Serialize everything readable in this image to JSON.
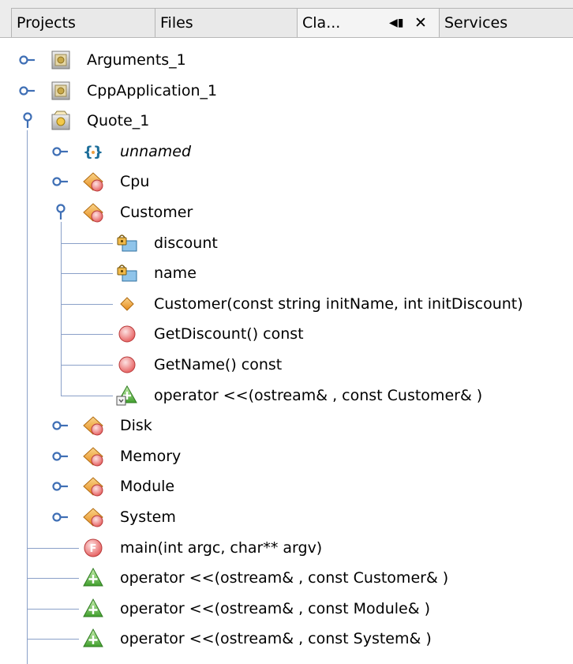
{
  "tabs": [
    {
      "label": "Projects"
    },
    {
      "label": "Files"
    },
    {
      "label": "Cla...",
      "active": true
    },
    {
      "label": "Services"
    }
  ],
  "tab_controls": {
    "minimize_glyph": "◀▮",
    "close_glyph": "✕"
  },
  "tree": {
    "items": [
      {
        "label": "Arguments_1",
        "icon": "project-icon",
        "state": "collapsed"
      },
      {
        "label": "CppApplication_1",
        "icon": "project-icon",
        "state": "collapsed"
      },
      {
        "label": "Quote_1",
        "icon": "project-open-icon",
        "state": "expanded"
      },
      {
        "label": "unnamed",
        "icon": "namespace-icon",
        "state": "collapsed",
        "italic": true
      },
      {
        "label": "Cpu",
        "icon": "class-icon",
        "state": "collapsed"
      },
      {
        "label": "Customer",
        "icon": "class-icon",
        "state": "expanded"
      },
      {
        "label": "discount",
        "icon": "private-field-icon"
      },
      {
        "label": "name",
        "icon": "private-field-icon"
      },
      {
        "label": "Customer(const string initName, int initDiscount)",
        "icon": "constructor-icon"
      },
      {
        "label": "GetDiscount() const",
        "icon": "method-icon"
      },
      {
        "label": "GetName() const",
        "icon": "method-icon"
      },
      {
        "label": "operator <<(ostream& , const Customer& )",
        "icon": "friend-operator-icon"
      },
      {
        "label": "Disk",
        "icon": "class-icon",
        "state": "collapsed"
      },
      {
        "label": "Memory",
        "icon": "class-icon",
        "state": "collapsed"
      },
      {
        "label": "Module",
        "icon": "class-icon",
        "state": "collapsed"
      },
      {
        "label": "System",
        "icon": "class-icon",
        "state": "collapsed"
      },
      {
        "label": "main(int argc, char** argv)",
        "icon": "function-icon"
      },
      {
        "label": "operator <<(ostream& , const Customer& )",
        "icon": "operator-icon"
      },
      {
        "label": "operator <<(ostream& , const Module& )",
        "icon": "operator-icon"
      },
      {
        "label": "operator <<(ostream& , const System& )",
        "icon": "operator-icon"
      }
    ]
  },
  "colors": {
    "guide_line": "#8aa0c8",
    "handle": "#3f6fb5",
    "class_orange": "#f0a040",
    "method_red": "#f07070",
    "operator_green": "#3aa040"
  }
}
